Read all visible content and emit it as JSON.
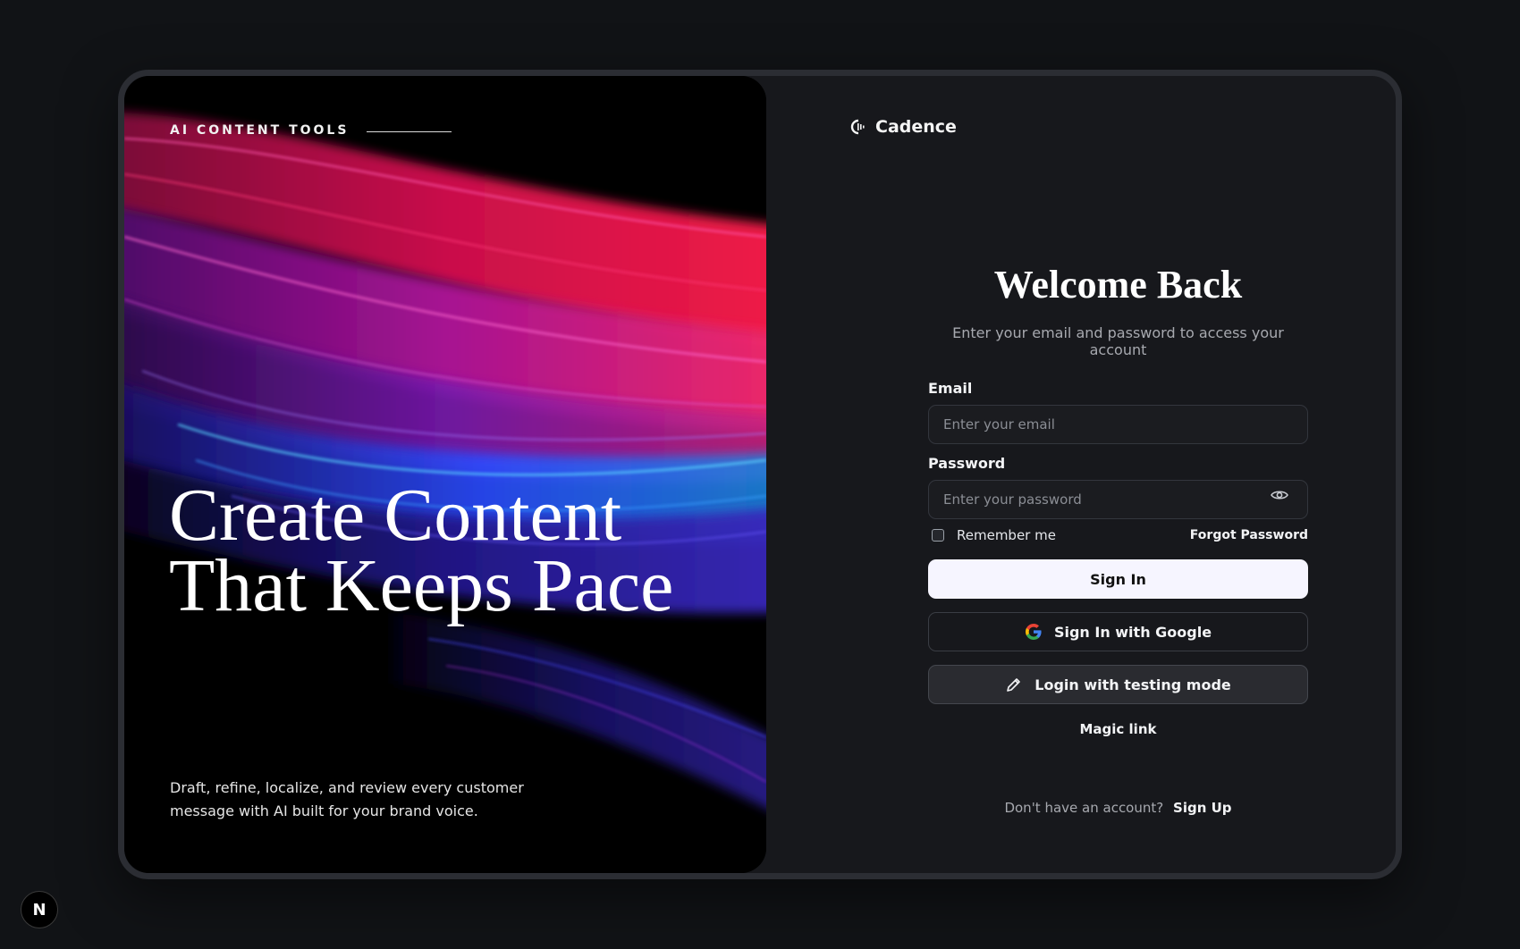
{
  "hero": {
    "eyebrow": "AI CONTENT TOOLS",
    "headline": "Create Content That Keeps Pace",
    "subtext": "Draft, refine, localize, and review every customer message with AI built for your brand voice."
  },
  "brand": {
    "name": "Cadence",
    "icon": "cadence-logo-icon"
  },
  "form": {
    "title": "Welcome Back",
    "subtitle": "Enter your email and password to access your account",
    "email_label": "Email",
    "email_placeholder": "Enter your email",
    "password_label": "Password",
    "password_placeholder": "Enter your password",
    "remember_label": "Remember me",
    "forgot_label": "Forgot Password",
    "sign_in_label": "Sign In",
    "google_label": "Sign In with Google",
    "testing_label": "Login with testing mode",
    "magic_link_label": "Magic link",
    "no_account_text": "Don't have an account?",
    "sign_up_label": "Sign Up"
  },
  "badge": {
    "label": "N"
  },
  "colors": {
    "page_bg": "#111316",
    "panel_bg": "#17181c",
    "primary_button_bg": "#f6f5ff",
    "hero_pink": "#e0105a",
    "hero_blue": "#2a5bff"
  }
}
